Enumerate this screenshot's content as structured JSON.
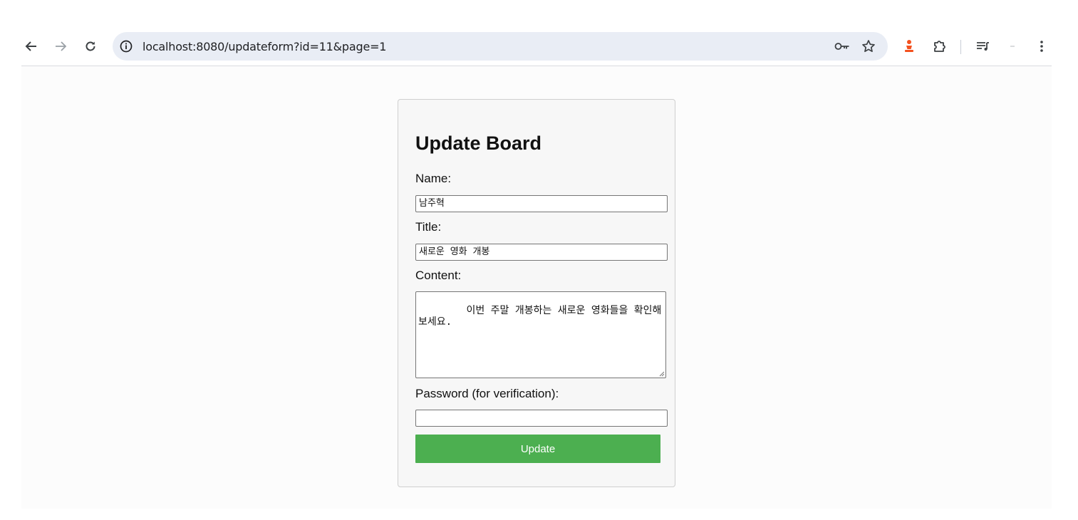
{
  "browser": {
    "url": "localhost:8080/updateform?id=11&page=1",
    "icons": {
      "back": "arrow-left-icon",
      "forward": "arrow-right-icon",
      "reload": "reload-icon",
      "site_info": "info-icon",
      "password_key": "key-icon",
      "bookmark": "star-icon",
      "extension_profile": "chess-piece-icon",
      "extensions": "puzzle-icon",
      "reading_list": "playlist-icon",
      "minimize": "dash-icon",
      "menu": "kebab-menu-icon"
    }
  },
  "form": {
    "title": "Update Board",
    "name_label": "Name:",
    "name_value": "남주혁",
    "title_label": "Title:",
    "title_value": "새로운 영화 개봉",
    "content_label": "Content:",
    "content_value": "이번 주말 개봉하는 새로운 영화들을 확인해 보세요.",
    "password_label": "Password (for verification):",
    "password_value": "",
    "submit_label": "Update"
  },
  "colors": {
    "button": "#4caf50",
    "button_text": "#ffffff",
    "card_bg": "#f7f7f7",
    "omnibox_bg": "#e9edf5"
  }
}
